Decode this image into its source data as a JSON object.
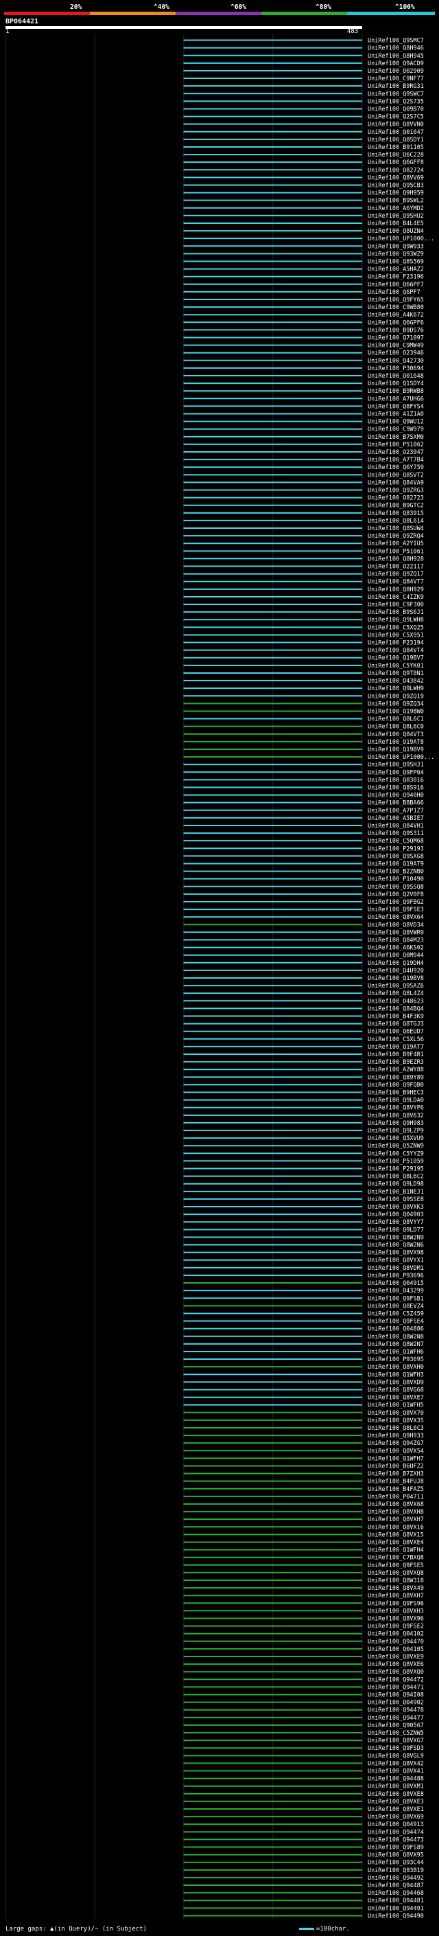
{
  "scale": {
    "labels": [
      "20%",
      "^40%",
      "^60%",
      "^80%",
      "^100%"
    ],
    "colors": [
      "#e8161e",
      "#f08a1e",
      "#8e2fb0",
      "#2ab02a",
      "#22c8e0"
    ]
  },
  "query": {
    "id": "BP064421",
    "start": "1",
    "end": "483"
  },
  "chart_data": {
    "type": "alignment-overview",
    "query_length": 483,
    "identity_color_scale": [
      {
        "min": 0,
        "max": 20,
        "color": "#e8161e"
      },
      {
        "min": 20,
        "max": 40,
        "color": "#f08a1e"
      },
      {
        "min": 40,
        "max": 60,
        "color": "#8e2fb0"
      },
      {
        "min": 60,
        "max": 80,
        "color": "#2ab02a"
      },
      {
        "min": 80,
        "max": 100,
        "color": "#22c8e0"
      }
    ],
    "hits": [
      "UniRef100_Q9SMC7",
      "UniRef100_Q8H946",
      "UniRef100_Q8H945",
      "UniRef100_Q9ACD9",
      "UniRef100_Q02909",
      "UniRef100_C9NF77",
      "UniRef100_B9RG31",
      "UniRef100_Q9SWC7",
      "UniRef100_Q2S735",
      "UniRef100_Q09B70",
      "UniRef100_Q2S7C5",
      "UniRef100_Q8VVN0",
      "UniRef100_Q01647",
      "UniRef100_Q8SDY1",
      "UniRef100_B91105",
      "UniRef100_Q6C228",
      "UniRef100_Q6GFF8",
      "UniRef100_O82724",
      "UniRef100_Q8VV69",
      "UniRef100_Q95CB3",
      "UniRef100_Q9H959",
      "UniRef100_B9SWL2",
      "UniRef100_A6YMD2",
      "UniRef100_Q9SHU2",
      "UniRef100_B4L4E5",
      "UniRef100_Q8UZN4",
      "UniRef100_UP1000...",
      "UniRef100_Q9W933",
      "UniRef100_Q93WZ9",
      "UniRef100_Q8S569",
      "UniRef100_A5HAZ2",
      "UniRef100_F23196",
      "UniRef100_Q66PF7",
      "UniRef100_Q6PF7",
      "UniRef100_Q9FY65",
      "UniRef100_C9WB80",
      "UniRef100_A4K672",
      "UniRef100_Q6GPF6",
      "UniRef100_B9DS76",
      "UniRef100_Q71097",
      "UniRef100_C9MW49",
      "UniRef100_O23946",
      "UniRef100_Q42730",
      "UniRef100_P30694",
      "UniRef100_Q01648",
      "UniRef100_Q1SDY4",
      "UniRef100_B9RWB8",
      "UniRef100_A7UHG6",
      "UniRef100_Q8FYS4",
      "UniRef100_A1Z1A0",
      "UniRef100_Q9WU12",
      "UniRef100_C9W979",
      "UniRef100_B7SXM0",
      "UniRef100_P51062",
      "UniRef100_O23947",
      "UniRef100_A7T7B4",
      "UniRef100_Q6Y759",
      "UniRef100_Q8SVT2",
      "UniRef100_Q84VA9",
      "UniRef100_Q9ZRG3",
      "UniRef100_O82723",
      "UniRef100_B9GTC2",
      "UniRef100_Q83915",
      "UniRef100_Q8L614",
      "UniRef100_Q8SUW4",
      "UniRef100_Q9ZRQ4",
      "UniRef100_A2YIU5",
      "UniRef100_P51061",
      "UniRef100_Q8H928",
      "UniRef100_O22117",
      "UniRef100_Q9ZQ17",
      "UniRef100_Q84VT7",
      "UniRef100_Q8H929",
      "UniRef100_C4IZK9",
      "UniRef100_C9F300",
      "UniRef100_B9S6J1",
      "UniRef100_Q9LWH8",
      "UniRef100_C5XQ25",
      "UniRef100_C5X951",
      "UniRef100_P23194",
      "UniRef100_Q84VT4",
      "UniRef100_Q19BV7",
      "UniRef100_C5YK01",
      "UniRef100_Q9T0N1",
      "UniRef100_O43842",
      "UniRef100_Q9LWH9",
      "UniRef100_Q9ZQ19",
      "UniRef100_Q9ZQ34",
      "UniRef100_Q19BW0",
      "UniRef100_Q8L6C1",
      "UniRef100_Q8L6C0",
      "UniRef100_Q84VT3",
      "UniRef100_Q19AT8",
      "UniRef100_Q19BV9",
      "UniRef100_UP1000...",
      "UniRef100_Q9SHJ1",
      "UniRef100_Q9FP04",
      "UniRef100_Q83016",
      "UniRef100_Q8S916",
      "UniRef100_Q940H0",
      "UniRef100_B8BA66",
      "UniRef100_A7P1Z7",
      "UniRef100_A5BIE7",
      "UniRef100_Q84VH1",
      "UniRef100_Q9S311",
      "UniRef100_C5QM68",
      "UniRef100_P29193",
      "UniRef100_Q9SXG8",
      "UniRef100_Q19AT9",
      "UniRef100_B2ZNB0",
      "UniRef100_P10490",
      "UniRef100_Q9SSQ8",
      "UniRef100_Q2V0F8",
      "UniRef100_Q9FBG2",
      "UniRef100_Q9FSE3",
      "UniRef100_Q8VX64",
      "UniRef100_Q8VD34",
      "UniRef100_Q8VWR9",
      "UniRef100_Q84M23",
      "UniRef100_A6KS02",
      "UniRef100_Q0M944",
      "UniRef100_Q19DH4",
      "UniRef100_Q4U920",
      "UniRef100_Q19BV8",
      "UniRef100_Q9SAZ6",
      "UniRef100_Q8L4Z4",
      "UniRef100_O48623",
      "UniRef100_Q84BQ4",
      "UniRef100_B4F3K9",
      "UniRef100_Q8TGJ3",
      "UniRef100_Q6EUD7",
      "UniRef100_C5XL56",
      "UniRef100_Q19AT7",
      "UniRef100_B9F4R1",
      "UniRef100_B9EZR3",
      "UniRef100_A2WY88",
      "UniRef100_Q89Y89",
      "UniRef100_Q9FQB0",
      "UniRef100_B9HEC3",
      "UniRef100_Q9LDA0",
      "UniRef100_Q8VYP6",
      "UniRef100_Q8V632",
      "UniRef100_Q9H983",
      "UniRef100_Q9LZP9",
      "UniRef100_Q5XVU9",
      "UniRef100_Q5ZNW9",
      "UniRef100_C5YYZ9",
      "UniRef100_P51059",
      "UniRef100_P29195",
      "UniRef100_Q8L6C2",
      "UniRef100_Q9LD98",
      "UniRef100_B1NEJ1",
      "UniRef100_Q9SSE8",
      "UniRef100_Q8VXK3",
      "UniRef100_Q04903",
      "UniRef100_Q8VYY7",
      "UniRef100_Q9LD77",
      "UniRef100_Q8W2N9",
      "UniRef100_Q8W2N6",
      "UniRef100_Q8VX98",
      "UniRef100_Q8VYX1",
      "UniRef100_Q8VDM1",
      "UniRef100_P93696",
      "UniRef100_Q04915",
      "UniRef100_O43299",
      "UniRef100_Q9FSB1",
      "UniRef100_Q8EVZ4",
      "UniRef100_C5Z459",
      "UniRef100_Q9FSE4",
      "UniRef100_Q04886",
      "UniRef100_Q8W2N8",
      "UniRef100_Q8W2N7",
      "UniRef100_Q1WFH6",
      "UniRef100_P93695",
      "UniRef100_Q8VXH0",
      "UniRef100_Q1WFH3",
      "UniRef100_Q8VXD9",
      "UniRef100_Q8VG68",
      "UniRef100_Q8VXE7",
      "UniRef100_Q1WFH5",
      "UniRef100_Q8VX70",
      "UniRef100_Q8VX35",
      "UniRef100_Q8L6C3",
      "UniRef100_Q9H933",
      "UniRef100_Q94ZG7",
      "UniRef100_Q8VX54",
      "UniRef100_Q1WFH7",
      "UniRef100_B6UFZ2",
      "UniRef100_B7ZXH3",
      "UniRef100_B4FUJ8",
      "UniRef100_B4FAZ5",
      "UniRef100_P04711",
      "UniRef100_Q8VX68",
      "UniRef100_Q8VXH8",
      "UniRef100_Q8VXH7",
      "UniRef100_Q8VX16",
      "UniRef100_Q8VX15",
      "UniRef100_Q8VXE4",
      "UniRef100_Q1WFH4",
      "UniRef100_C7BXQ8",
      "UniRef100_Q9FSE5",
      "UniRef100_Q8VXQ8",
      "UniRef100_Q8W318",
      "UniRef100_Q8VX49",
      "UniRef100_Q8VXH7",
      "UniRef100_Q9FS96",
      "UniRef100_Q8VXH3",
      "UniRef100_Q8VX96",
      "UniRef100_Q9FSE2",
      "UniRef100_Q04102",
      "UniRef100_Q94470",
      "UniRef100_Q04105",
      "UniRef100_Q8VXE9",
      "UniRef100_Q8VXE6",
      "UniRef100_Q8VXQ0",
      "UniRef100_Q94472",
      "UniRef100_Q94471",
      "UniRef100_Q94I08",
      "UniRef100_Q04902",
      "UniRef100_Q94478",
      "UniRef100_Q94477",
      "UniRef100_Q90567",
      "UniRef100_C5ZNW5",
      "UniRef100_Q8VXG7",
      "UniRef100_Q9FSD3",
      "UniRef100_Q8VGL9",
      "UniRef100_Q8VX42",
      "UniRef100_Q8VX41",
      "UniRef100_Q94488",
      "UniRef100_Q8VXM1",
      "UniRef100_Q8VXE8",
      "UniRef100_Q8VXE3",
      "UniRef100_Q8VXE1",
      "UniRef100_Q8VX69",
      "UniRef100_Q04913",
      "UniRef100_Q94474",
      "UniRef100_Q94473",
      "UniRef100_Q9FS89",
      "UniRef100_Q8VX95",
      "UniRef100_Q93C44",
      "UniRef100_Q93B19",
      "UniRef100_Q94492",
      "UniRef100_Q94487",
      "UniRef100_Q94468",
      "UniRef100_Q94481",
      "UniRef100_Q94491",
      "UniRef100_Q94490"
    ],
    "hit_colors": [
      "#44d6e8",
      "#44d6e8",
      "#44d6e8",
      "#44d6e8",
      "#44d6e8",
      "#44d6e8",
      "#44d6e8",
      "#44d6e8",
      "#44d6e8",
      "#44d6e8",
      "#44d6e8",
      "#44d6e8",
      "#44d6e8",
      "#44d6e8",
      "#44d6e8",
      "#44d6e8",
      "#44d6e8",
      "#44d6e8",
      "#44d6e8",
      "#44d6e8",
      "#44d6e8",
      "#44d6e8",
      "#44d6e8",
      "#44d6e8",
      "#44d6e8",
      "#44d6e8",
      "#44d6e8",
      "#44d6e8",
      "#44d6e8",
      "#44d6e8",
      "#44d6e8",
      "#44d6e8",
      "#44d6e8",
      "#44d6e8",
      "#44d6e8",
      "#44d6e8",
      "#44d6e8",
      "#44d6e8",
      "#44d6e8",
      "#44d6e8",
      "#44d6e8",
      "#44d6e8",
      "#44d6e8",
      "#44d6e8",
      "#44d6e8",
      "#44d6e8",
      "#44d6e8",
      "#44d6e8",
      "#44d6e8",
      "#44d6e8",
      "#44d6e8",
      "#44d6e8",
      "#44d6e8",
      "#44d6e8",
      "#44d6e8",
      "#44d6e8",
      "#44d6e8",
      "#44d6e8",
      "#44d6e8",
      "#44d6e8",
      "#44d6e8",
      "#44d6e8",
      "#44d6e8",
      "#44d6e8",
      "#44d6e8",
      "#44d6e8",
      "#44d6e8",
      "#44d6e8",
      "#44d6e8",
      "#44d6e8",
      "#44d6e8",
      "#44d6e8",
      "#44d6e8",
      "#44d6e8",
      "#44d6e8",
      "#44d6e8",
      "#44d6e8",
      "#44d6e8",
      "#44d6e8",
      "#44d6e8",
      "#44d6e8",
      "#44d6e8",
      "#44d6e8",
      "#44d6e8",
      "#44d6e8",
      "#44d6e8",
      "#44d6e8",
      "#2ab02a",
      "#2ab02a",
      "#44d6e8",
      "#2ab02a",
      "#2ab02a",
      "#2ab02a",
      "#2ab02a",
      "#2ab02a",
      "#44d6e8",
      "#44d6e8",
      "#44d6e8",
      "#44d6e8",
      "#44d6e8",
      "#44d6e8",
      "#44d6e8",
      "#44d6e8",
      "#44d6e8",
      "#44d6e8",
      "#44d6e8",
      "#44d6e8",
      "#44d6e8",
      "#44d6e8",
      "#44d6e8",
      "#44d6e8",
      "#44d6e8",
      "#44d6e8",
      "#44d6e8",
      "#44d6e8",
      "#44d6e8",
      "#2ab02a",
      "#44d6e8",
      "#44d6e8",
      "#44d6e8",
      "#44d6e8",
      "#44d6e8",
      "#44d6e8",
      "#44d6e8",
      "#44d6e8",
      "#44d6e8",
      "#44d6e8",
      "#44d6e8",
      "#44d6e8",
      "#44d6e8",
      "#44d6e8",
      "#44d6e8",
      "#44d6e8",
      "#44d6e8",
      "#44d6e8",
      "#44d6e8",
      "#44d6e8",
      "#44d6e8",
      "#44d6e8",
      "#44d6e8",
      "#44d6e8",
      "#44d6e8",
      "#44d6e8",
      "#44d6e8",
      "#44d6e8",
      "#44d6e8",
      "#44d6e8",
      "#44d6e8",
      "#44d6e8",
      "#44d6e8",
      "#44d6e8",
      "#44d6e8",
      "#44d6e8",
      "#44d6e8",
      "#44d6e8",
      "#44d6e8",
      "#44d6e8",
      "#44d6e8",
      "#44d6e8",
      "#44d6e8",
      "#44d6e8",
      "#44d6e8",
      "#44d6e8",
      "#2ab02a",
      "#44d6e8",
      "#44d6e8",
      "#2ab02a",
      "#44d6e8",
      "#44d6e8",
      "#44d6e8",
      "#44d6e8",
      "#44d6e8",
      "#44d6e8",
      "#44d6e8",
      "#2ab02a",
      "#44d6e8",
      "#44d6e8",
      "#44d6e8",
      "#44d6e8",
      "#44d6e8",
      "#2ab02a",
      "#2ab02a",
      "#2ab02a",
      "#2ab02a",
      "#2ab02a",
      "#2ab02a",
      "#2ab02a",
      "#2ab02a",
      "#2ab02a",
      "#2ab02a",
      "#2ab02a",
      "#2ab02a",
      "#2ab02a",
      "#2ab02a",
      "#2ab02a",
      "#2ab02a",
      "#2ab02a",
      "#2ab02a",
      "#2ab02a",
      "#2ab02a",
      "#2ab02a",
      "#2ab02a",
      "#2ab02a",
      "#2ab02a",
      "#2ab02a",
      "#2ab02a",
      "#2ab02a",
      "#2ab02a",
      "#2ab02a",
      "#2ab02a",
      "#2ab02a",
      "#2ab02a",
      "#2ab02a",
      "#2ab02a",
      "#2ab02a",
      "#2ab02a",
      "#2ab02a",
      "#2ab02a",
      "#2ab02a",
      "#2ab02a",
      "#2ab02a",
      "#2ab02a",
      "#2ab02a",
      "#2ab02a",
      "#2ab02a",
      "#2ab02a",
      "#2ab02a",
      "#2ab02a",
      "#2ab02a",
      "#2ab02a",
      "#2ab02a",
      "#2ab02a",
      "#2ab02a",
      "#2ab02a",
      "#2ab02a",
      "#2ab02a",
      "#2ab02a",
      "#2ab02a",
      "#2ab02a",
      "#2ab02a",
      "#2ab02a",
      "#2ab02a",
      "#2ab02a",
      "#2ab02a",
      "#2ab02a",
      "#2ab02a",
      "#2ab02a",
      "#2ab02a",
      "#2ab02a",
      "#2ab02a",
      "#2ab02a",
      "#2ab02a",
      "#2ab02a",
      "#2ab02a",
      "#2ab02a",
      "#2ab02a",
      "#2ab02a"
    ],
    "hit_start": 241,
    "hit_end": 483
  },
  "footer": {
    "text": "Large gaps: ▲(in Query)/~ (in Subject)"
  },
  "legend": {
    "text": "=100char."
  }
}
